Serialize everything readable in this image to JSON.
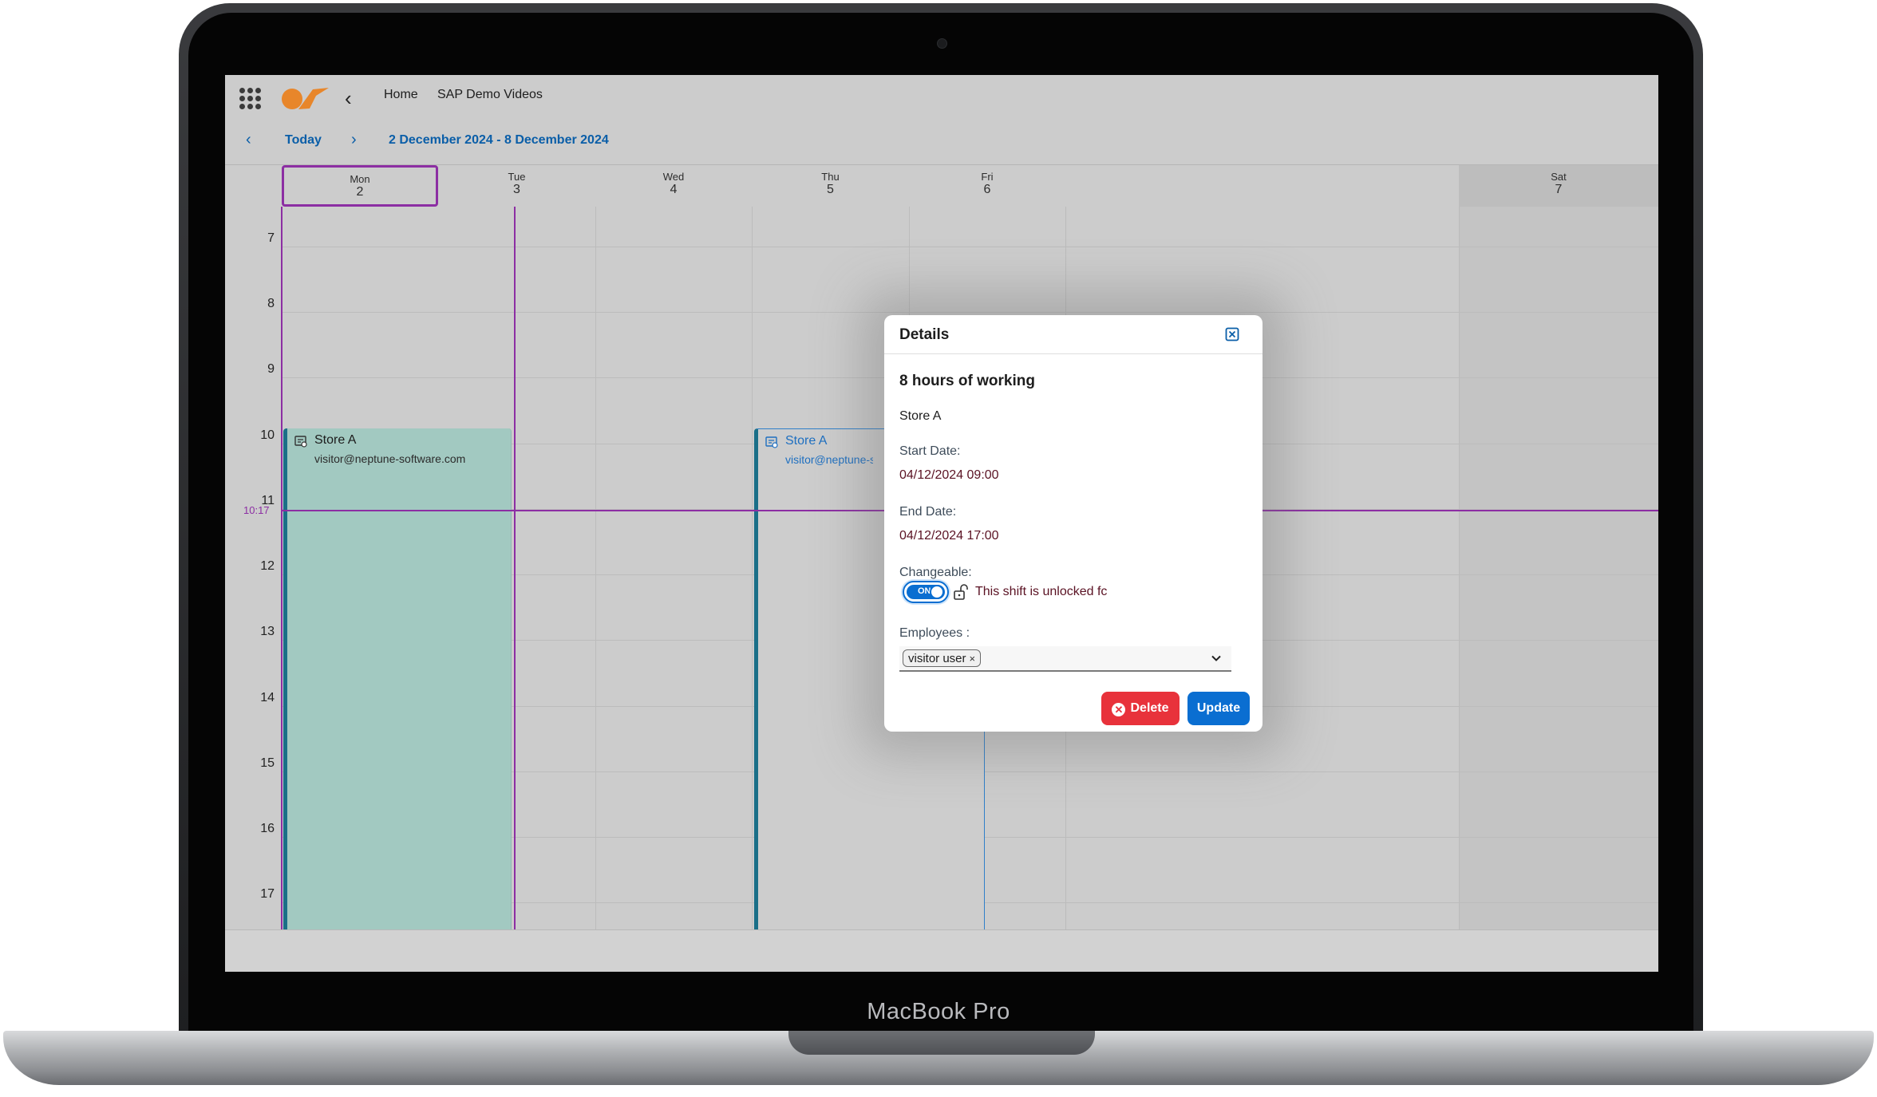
{
  "device": {
    "brand_label": "MacBook Pro"
  },
  "header": {
    "breadcrumbs": [
      "Home",
      "SAP Demo Videos"
    ],
    "logo_colors": {
      "primary": "#e8862a"
    }
  },
  "date_nav": {
    "prev_icon": "chevron-left-icon",
    "today_label": "Today",
    "next_icon": "chevron-right-icon",
    "range_label": "2 December 2024 - 8 December 2024"
  },
  "calendar": {
    "days": [
      {
        "name": "Mon",
        "num": "2"
      },
      {
        "name": "Tue",
        "num": "3"
      },
      {
        "name": "Wed",
        "num": "4"
      },
      {
        "name": "Thu",
        "num": "5"
      },
      {
        "name": "Fri",
        "num": "6"
      },
      {
        "name": "Sat",
        "num": "7"
      }
    ],
    "hours": [
      "7",
      "8",
      "9",
      "10",
      "11",
      "12",
      "13",
      "14",
      "15",
      "16",
      "17"
    ],
    "now_label": "10:17",
    "events": [
      {
        "title": "Store A",
        "subtitle": "visitor@neptune-software.com"
      },
      {
        "title": "Store A",
        "subtitle": "visitor@neptune-software.com"
      }
    ],
    "colors": {
      "today": "#8c2ea3",
      "event_fill": "#a2c9c1",
      "event_border": "#1a6f88"
    }
  },
  "dialog": {
    "title": "Details",
    "heading": "8 hours of working",
    "store": "Store A",
    "start_label": "Start Date:",
    "start_value": "04/12/2024 09:00",
    "end_label": "End Date:",
    "end_value": "04/12/2024 17:00",
    "changeable_label": "Changeable:",
    "toggle_text": "ON",
    "lock_text": "This shift is unlocked fc",
    "employees_label": "Employees :",
    "employee_token": "visitor user",
    "token_remove": "×",
    "delete_label": "Delete",
    "update_label": "Update",
    "colors": {
      "delete": "#e8323b",
      "update": "#0a6ed1"
    }
  }
}
